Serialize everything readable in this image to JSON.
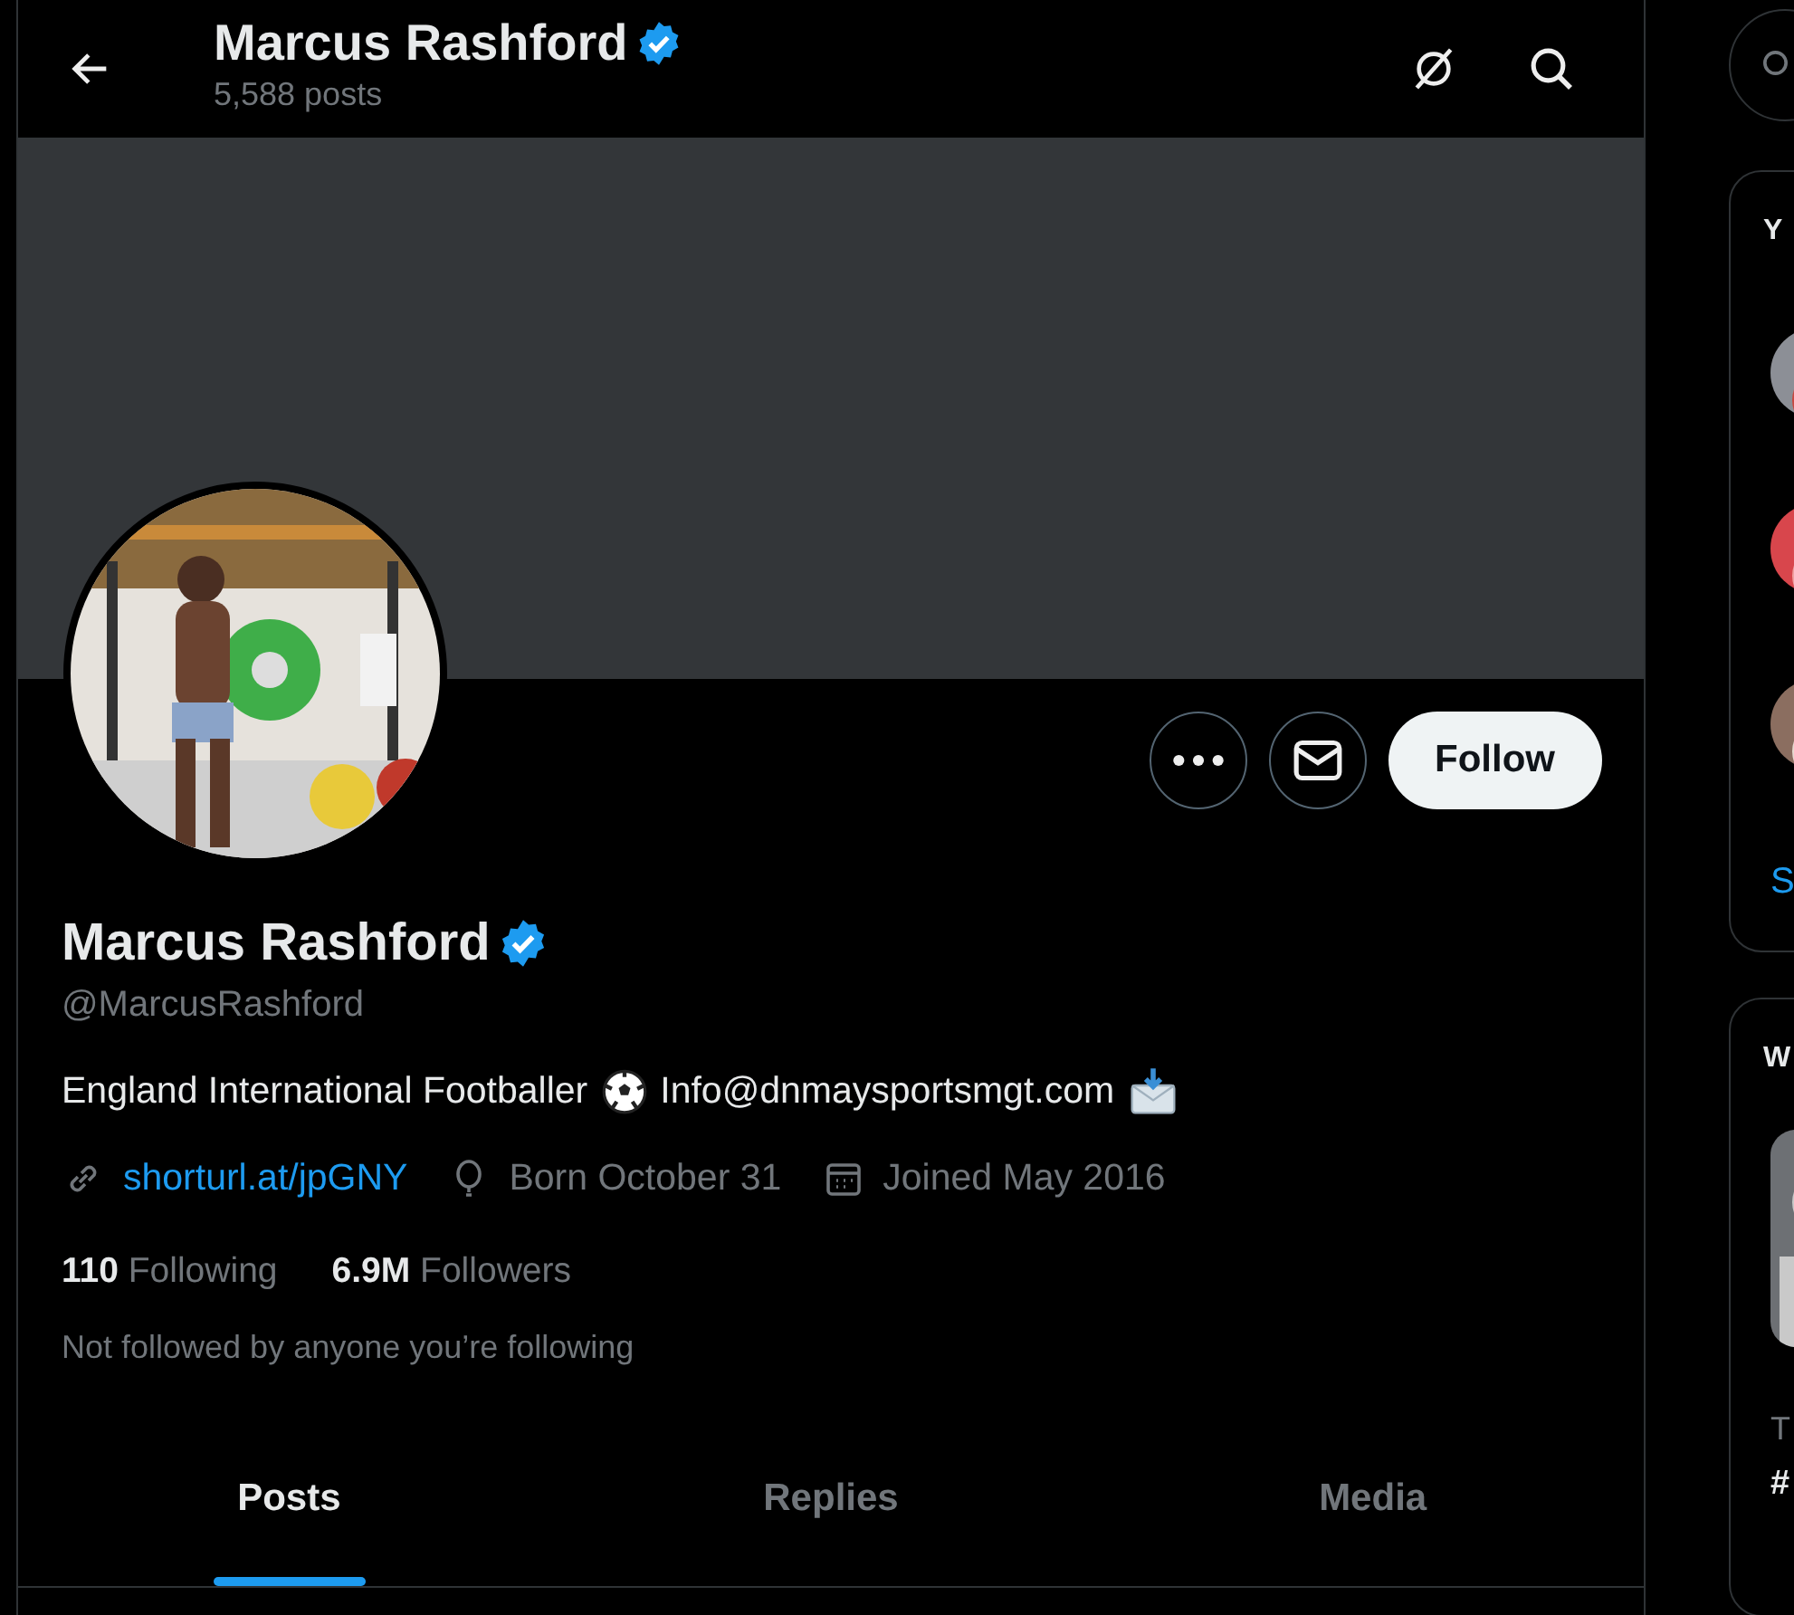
{
  "header": {
    "title": "Marcus Rashford",
    "verified": true,
    "posts": "5,588 posts"
  },
  "profile": {
    "name": "Marcus Rashford",
    "verified": true,
    "handle": "@MarcusRashford",
    "follow_button": "Follow",
    "bio": [
      {
        "kind": "text",
        "text": "England International Footballer"
      },
      {
        "kind": "ball"
      },
      {
        "kind": "text",
        "text": "Info@dnmaysportsmgt.com"
      },
      {
        "kind": "mail"
      }
    ],
    "meta": [
      {
        "kind": "link",
        "text": "shorturl.at/jpGNY"
      },
      {
        "kind": "birthday",
        "text": "Born October 31"
      },
      {
        "kind": "joined",
        "text": "Joined May 2016"
      }
    ],
    "stats": [
      {
        "count": "110",
        "label": "Following"
      },
      {
        "count": "6.9M",
        "label": "Followers"
      }
    ],
    "followed_by": "Not followed by anyone you’re following"
  },
  "tabs": [
    {
      "label": "Posts",
      "selected": true
    },
    {
      "label": "Replies",
      "selected": false
    },
    {
      "label": "Media",
      "selected": false
    }
  ],
  "sidebar": {
    "card_1": {
      "title": "Y",
      "link": "S"
    },
    "card_2": {
      "title": "W",
      "line_1": "T",
      "line_2": "#"
    }
  }
}
